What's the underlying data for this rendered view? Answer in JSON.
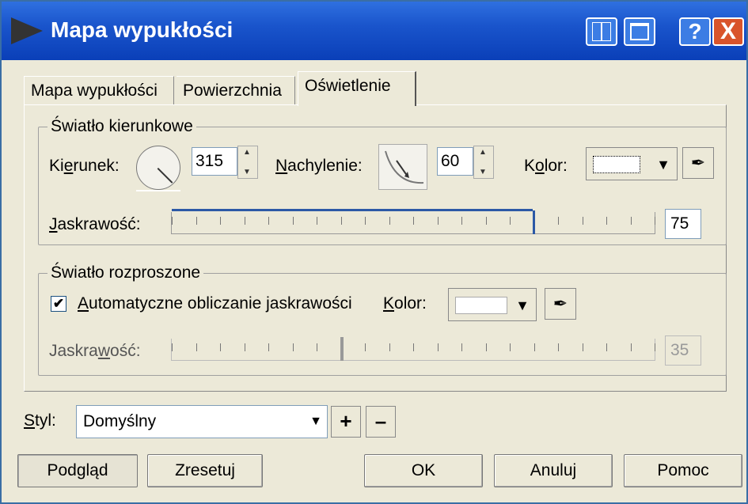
{
  "window": {
    "title": "Mapa wypukłości",
    "help_label": "?",
    "close_label": "X",
    "split_icon": "split-view-icon",
    "maximize_icon": "maximize-icon"
  },
  "tabs": [
    {
      "label": "Mapa wypukłości"
    },
    {
      "label": "Powierzchnia"
    },
    {
      "label": "Oświetlenie"
    }
  ],
  "directional": {
    "legend": "Światło kierunkowe",
    "direction_label_pre": "Ki",
    "direction_label_u": "e",
    "direction_label_post": "runek:",
    "direction_value": "315",
    "tilt_label_u": "N",
    "tilt_label_post": "achylenie:",
    "tilt_value": "60",
    "color_label_pre": "K",
    "color_label_u": "o",
    "color_label_post": "lor:",
    "brightness_label_u": "J",
    "brightness_label_post": "askrawość:",
    "brightness_value": "75",
    "brightness_level": 75
  },
  "diffuse": {
    "legend": "Światło rozproszone",
    "auto_label_u": "A",
    "auto_label_post": "utomatyczne obliczanie jaskrawości",
    "auto_checked": true,
    "checkmark": "✔",
    "color_label_u": "K",
    "color_label_post": "olor:",
    "brightness_label_pre": "Jaskra",
    "brightness_label_u": "w",
    "brightness_label_post": "ość:",
    "brightness_value": "35",
    "brightness_level": 35
  },
  "style": {
    "label_u": "S",
    "label_post": "tyl:",
    "selected": "Domyślny",
    "plus": "+",
    "minus": "–"
  },
  "buttons": {
    "preview": "Podgląd",
    "reset": "Zresetuj",
    "ok": "OK",
    "cancel": "Anuluj",
    "help": "Pomoc"
  },
  "icons": {
    "dropdown": "▼",
    "eyedropper": "✒"
  }
}
